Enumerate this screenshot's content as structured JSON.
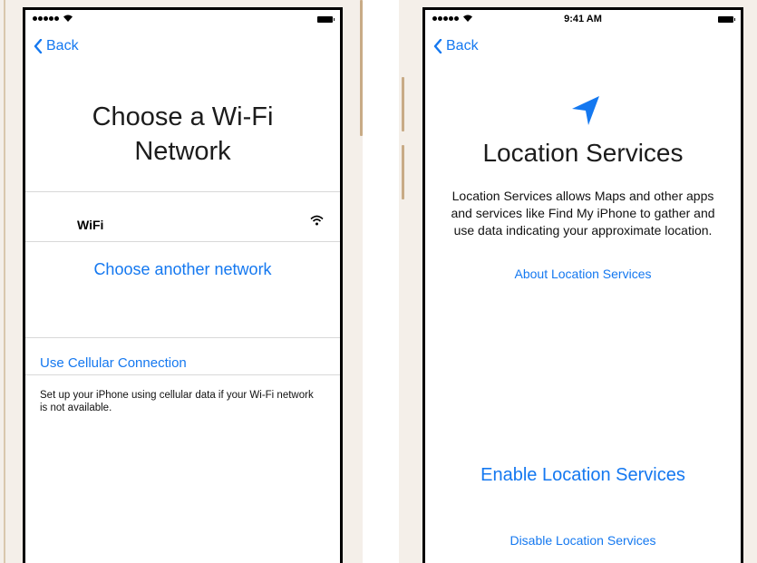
{
  "left_screen": {
    "back_label": "Back",
    "title_line1": "Choose a Wi-Fi",
    "title_line2": "Network",
    "networks": [
      {
        "name": "WiFi"
      }
    ],
    "choose_another": "Choose another network",
    "cellular_label": "Use Cellular Connection",
    "cellular_description": "Set up your iPhone using cellular data if your Wi-Fi network is not available."
  },
  "right_screen": {
    "status_time": "9:41 AM",
    "back_label": "Back",
    "title": "Location Services",
    "description": "Location Services allows Maps and other apps and services like Find My iPhone to gather and use data indicating your approximate location.",
    "about_link": "About Location Services",
    "enable_button": "Enable Location Services",
    "disable_button": "Disable Location Services"
  },
  "colors": {
    "accent": "#1478f0",
    "phone_frame": "#f4efe9",
    "phone_trim": "#c8ab86"
  }
}
